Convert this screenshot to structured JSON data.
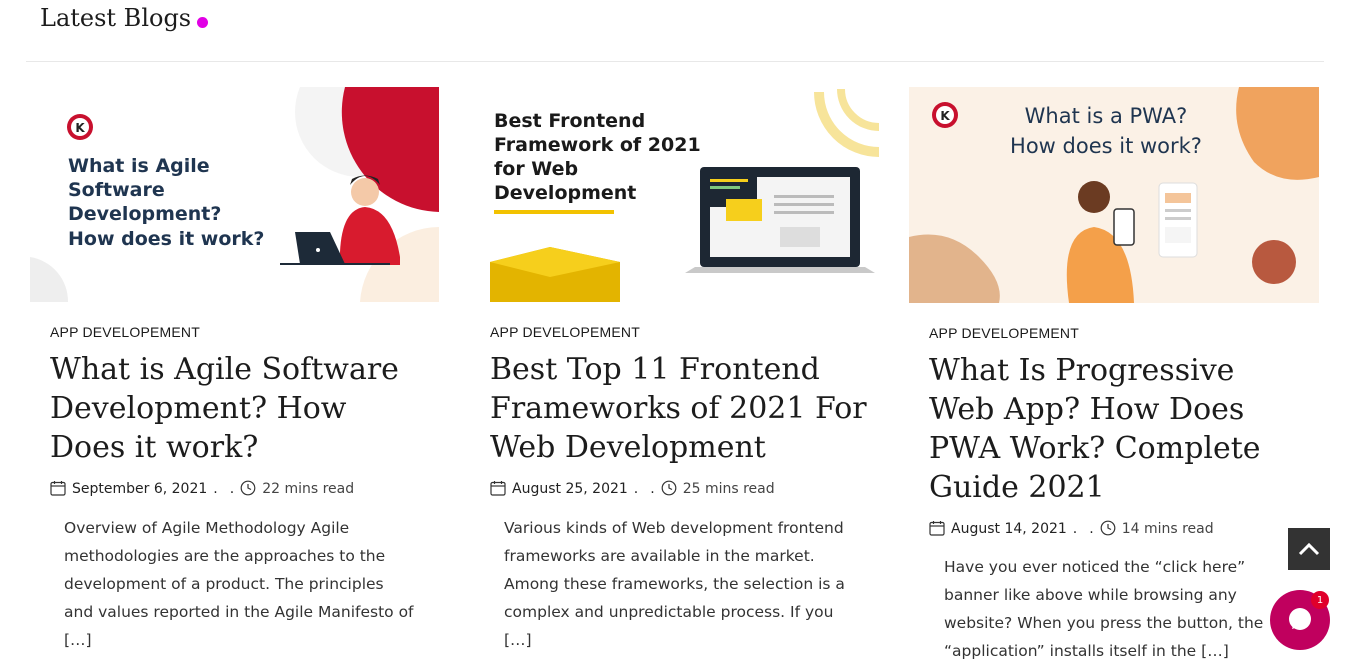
{
  "section": {
    "title": "Latest Blogs"
  },
  "colors": {
    "accent_dot": "#e100e5",
    "chat": "#c0005e",
    "back_to_top": "#333333"
  },
  "posts": [
    {
      "category": "APP DEVELOPEMENT",
      "title": "What is Agile Software Development? How Does it work?",
      "date": "September 6, 2021",
      "read_time": "22 mins read",
      "excerpt": "Overview of Agile Methodology Agile methodologies are the approaches to the development of a product. The principles and values reported in the Agile Manifesto of […]",
      "image": {
        "headline_lines": [
          "What is Agile",
          "Software",
          "Development?",
          "How does it work?"
        ],
        "logo": "K"
      }
    },
    {
      "category": "APP DEVELOPEMENT",
      "title": "Best Top 11 Frontend Frameworks of 2021 For Web Development",
      "date": "August 25, 2021",
      "read_time": "25 mins read",
      "excerpt": "Various kinds of Web development frontend frameworks are available in the market. Among these frameworks, the selection is a complex and unpredictable process. If you […]",
      "image": {
        "headline_lines": [
          "Best Frontend",
          "Framework of 2021",
          "for Web",
          "Development"
        ]
      }
    },
    {
      "category": "APP DEVELOPEMENT",
      "title": "What Is Progressive Web App? How Does PWA Work? Complete Guide 2021",
      "date": "August 14, 2021",
      "read_time": "14 mins read",
      "excerpt": "Have you ever noticed the “click here” banner like above while browsing any website? When you press the button, the “application” installs itself in the […]",
      "image": {
        "headline_lines": [
          "What is a PWA?",
          "How does it work?"
        ],
        "logo": "K"
      }
    }
  ],
  "widgets": {
    "chat_badge": "1"
  },
  "icons": [
    "calendar-icon",
    "clock-icon",
    "chevron-up-icon",
    "chat-icon"
  ]
}
